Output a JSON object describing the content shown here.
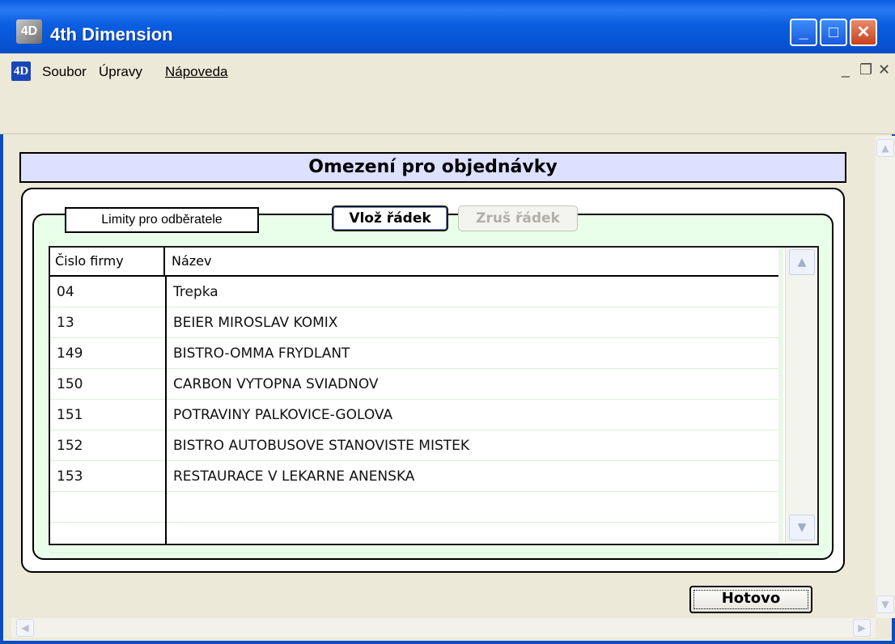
{
  "window": {
    "title": "4th Dimension",
    "controls": {
      "minimize": "_",
      "maximize": "□",
      "close": "✕"
    }
  },
  "menubar": {
    "logo": "4D",
    "items": [
      "Soubor",
      "Úpravy",
      "Nápoveda"
    ],
    "controls": {
      "minimize": "_",
      "restore": "❐",
      "close": "✕"
    }
  },
  "form": {
    "title": "Omezení pro objednávky",
    "group_label": "Limity pro odběratele",
    "add_row_label": "Vlož řádek",
    "delete_row_label": "Zruš řádek",
    "done_label": "Hotovo"
  },
  "table": {
    "columns": [
      "Čislo firmy",
      "Název"
    ],
    "rows": [
      [
        "04",
        "Trepka"
      ],
      [
        "13",
        "BEIER MIROSLAV KOMIX"
      ],
      [
        "149",
        "BISTRO-OMMA FRYDLANT"
      ],
      [
        "150",
        "CARBON VYTOPNA SVIADNOV"
      ],
      [
        "151",
        "POTRAVINY PALKOVICE-GOLOVA"
      ],
      [
        "152",
        "BISTRO AUTOBUSOVE STANOVISTE MISTEK"
      ],
      [
        "153",
        "RESTAURACE V LEKARNE ANENSKA"
      ],
      [
        "",
        ""
      ],
      [
        "",
        ""
      ]
    ]
  },
  "icons": {
    "scroll_up": "▲",
    "scroll_down": "▼",
    "scroll_left": "◀",
    "scroll_right": "▶"
  },
  "colors": {
    "titlebar": "#0a5fe0",
    "header_bg": "#dde0ff",
    "panel_bg": "#eaffea",
    "window_bg": "#ece9d8"
  }
}
